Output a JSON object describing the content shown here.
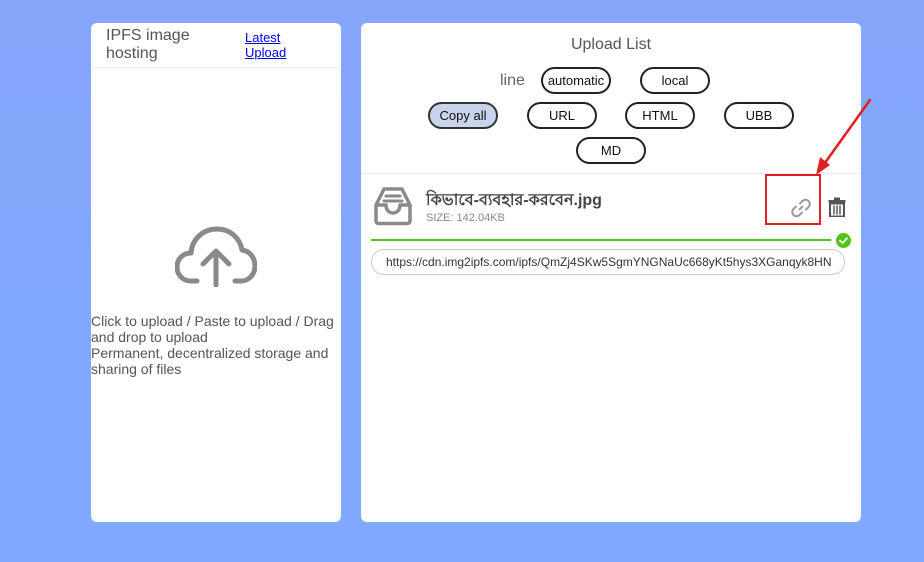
{
  "left_panel": {
    "title": "IPFS image hosting",
    "latest_upload_link": "Latest Upload",
    "upload_hint_line1": "Click to upload / Paste to upload / Drag and drop to upload",
    "upload_hint_line2": "Permanent, decentralized storage and sharing of files",
    "icon": "cloud-upload-icon"
  },
  "right_panel": {
    "title": "Upload List",
    "line_label": "line",
    "line_options": [
      "automatic",
      "local"
    ],
    "copy_buttons": [
      "Copy all",
      "URL",
      "HTML",
      "UBB",
      "MD"
    ],
    "active_copy_button": "Copy all"
  },
  "file": {
    "name": "কিভাবে-ব্যবহার-করবেন.jpg",
    "size": "SIZE: 142.04KB",
    "url": "https://cdn.img2ipfs.com/ipfs/QmZj4SKw5SgmYNGNaUc668yKt5hys3XGanqyk8HN",
    "progress": 1.0,
    "status": "complete",
    "icons": [
      "inbox-icon",
      "link-icon",
      "trash-icon",
      "check-circle-icon"
    ]
  },
  "colors": {
    "background": "#7fa9ff",
    "progress_fill": "#52c41a",
    "highlight_box": "#e02020",
    "active_button": "#c9d3ec"
  }
}
